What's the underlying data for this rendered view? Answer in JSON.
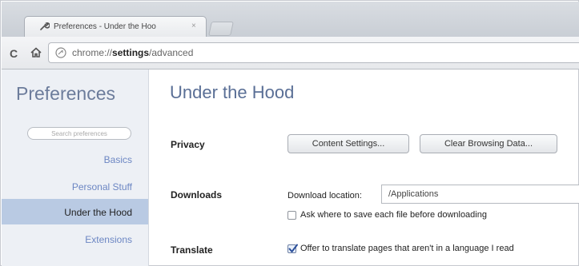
{
  "browser": {
    "tab_title": "Preferences - Under the Hoo",
    "tab_close": "×",
    "url_prefix": "chrome://",
    "url_bold": "settings",
    "url_suffix": "/advanced"
  },
  "sidebar": {
    "title": "Preferences",
    "search_placeholder": "Search preferences",
    "items": [
      {
        "label": "Basics",
        "selected": false
      },
      {
        "label": "Personal Stuff",
        "selected": false
      },
      {
        "label": "Under the Hood",
        "selected": true
      },
      {
        "label": "Extensions",
        "selected": false
      }
    ]
  },
  "main": {
    "title": "Under the Hood",
    "privacy": {
      "label": "Privacy",
      "content_settings_button": "Content Settings...",
      "clear_browsing_button": "Clear Browsing Data..."
    },
    "downloads": {
      "label": "Downloads",
      "location_label": "Download location:",
      "location_value": "/Applications",
      "ask_checkbox_label": "Ask where to save each file before downloading",
      "ask_checked": false
    },
    "translate": {
      "label": "Translate",
      "offer_checkbox_label": "Offer to translate pages that aren't in a language I read",
      "offer_checked": true
    }
  },
  "colors": {
    "sidebar_bg": "#edf0f5",
    "selected_item_bg": "#b9cae3",
    "nav_link": "#6c86c3",
    "title": "#5a6f96"
  }
}
